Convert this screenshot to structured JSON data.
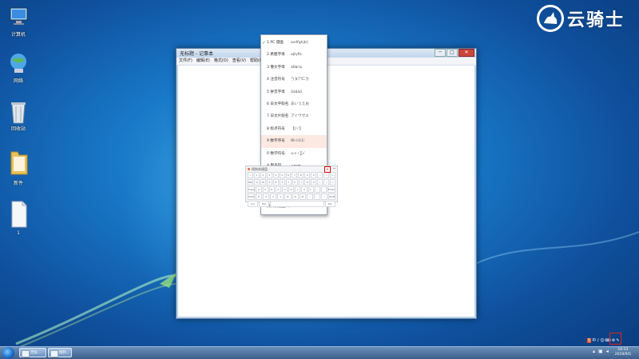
{
  "desktop": {
    "icons": [
      {
        "label": "计算机",
        "icon": "computer-icon"
      },
      {
        "label": "网络",
        "icon": "network-icon"
      },
      {
        "label": "回收站",
        "icon": "recycle-bin-icon"
      },
      {
        "label": "新件",
        "icon": "folder-icon"
      },
      {
        "label": "1",
        "icon": "text-file-icon"
      }
    ]
  },
  "watermark": {
    "text": "云骑士"
  },
  "notepad": {
    "title": "无标题 - 记事本",
    "menus": [
      "文件(F)",
      "编辑(E)",
      "格式(O)",
      "查看(V)",
      "帮助(H)"
    ],
    "min": "─",
    "max": "□",
    "close": "✕"
  },
  "soft_keyboard_menu": {
    "items": [
      {
        "name": "1 PC 键盘",
        "sample": "asdfghjkl;",
        "checked": true
      },
      {
        "name": "2 希腊字母",
        "sample": "αβγδε"
      },
      {
        "name": "3 俄文字母",
        "sample": "абвгд"
      },
      {
        "name": "4 注音符号",
        "sample": "ㄅㄆㄇㄈㄉ"
      },
      {
        "name": "5 拼音字母",
        "sample": "āáǎàō"
      },
      {
        "name": "6 日文平假名",
        "sample": "あいうえお"
      },
      {
        "name": "7 日文片假名",
        "sample": "アイウヴエ"
      },
      {
        "name": "8 标点符号",
        "sample": "【|〃】"
      },
      {
        "name": "9 数字序号",
        "sample": "ⅠⅡ㈠①⑴",
        "highlight": true
      },
      {
        "name": "0 数学符号",
        "sample": "±×÷∑√"
      },
      {
        "name": "A 制表符",
        "sample": "┌┍┎┏┐"
      },
      {
        "name": "B 中文数字",
        "sample": "壹贰千万兆"
      },
      {
        "name": "C 特殊符号",
        "sample": "▲☆◆□→"
      }
    ],
    "close_label": "关闭软键盘(L)"
  },
  "soft_keyboard": {
    "title": "搜狗软键盘",
    "close": "×",
    "min": "─",
    "rows": [
      [
        "~",
        "1",
        "2",
        "3",
        "4",
        "5",
        "6",
        "7",
        "8",
        "9",
        "0",
        "-",
        "=",
        "←"
      ],
      [
        "Tab",
        "Q",
        "W",
        "E",
        "R",
        "T",
        "Y",
        "U",
        "I",
        "O",
        "P",
        "[",
        "]",
        "\\"
      ],
      [
        "Caps",
        "A",
        "S",
        "D",
        "F",
        "G",
        "H",
        "J",
        "K",
        "L",
        ";",
        "'",
        "Enter"
      ],
      [
        "Shift",
        "Z",
        "X",
        "C",
        "V",
        "B",
        "N",
        "M",
        ",",
        ".",
        "/",
        "Shift"
      ],
      [
        "Ins",
        "Del",
        "",
        "Esc"
      ]
    ]
  },
  "taskbar": {
    "buttons": [
      {
        "label": "无标...",
        "icon": "notepad-icon"
      },
      {
        "label": "搜狗...",
        "icon": "window-icon"
      }
    ],
    "ime": [
      "S",
      "中",
      "♪",
      "☺",
      "⌨",
      "⚙",
      "✎"
    ],
    "time": "16:13",
    "date": "2019/9/5"
  }
}
